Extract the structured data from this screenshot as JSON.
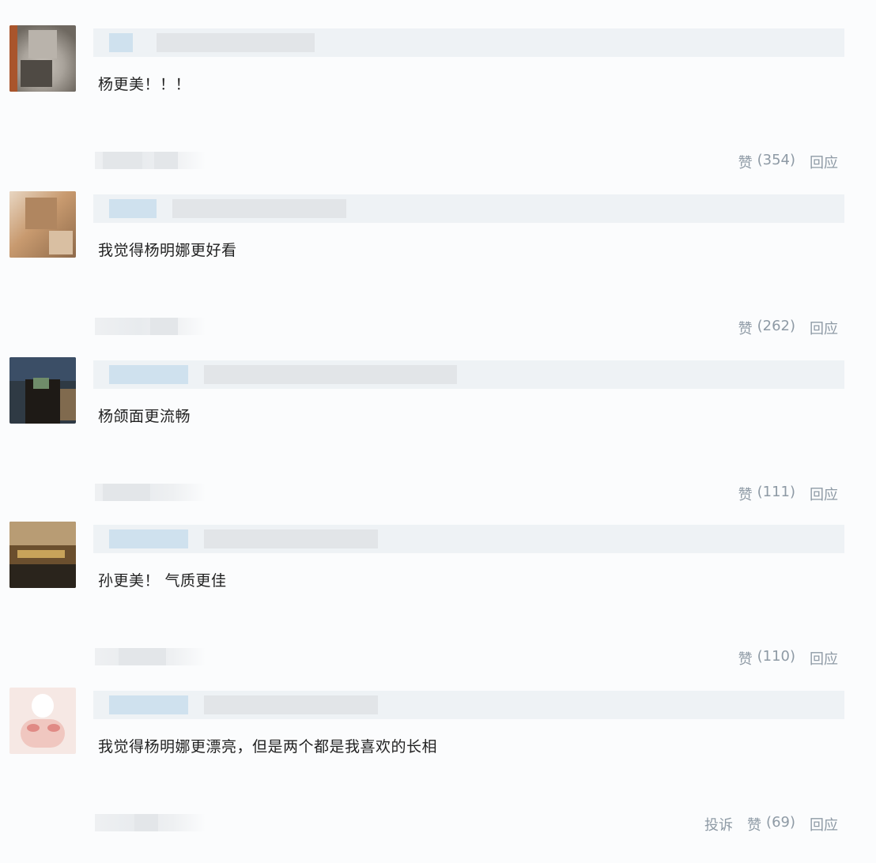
{
  "comments": [
    {
      "text": "杨更美！！！",
      "like_icon": "赞",
      "like_count": "(354)",
      "reply": "回应"
    },
    {
      "text": "我觉得杨明娜更好看",
      "like_icon": "赞",
      "like_count": "(262)",
      "reply": "回应"
    },
    {
      "text": "杨颌面更流畅",
      "like_icon": "赞",
      "like_count": "(111)",
      "reply": "回应"
    },
    {
      "text": "孙更美！ 气质更佳",
      "like_icon": "赞",
      "like_count": "(110)",
      "reply": "回应"
    },
    {
      "text": "我觉得杨明娜更漂亮，但是两个都是我喜欢的长相",
      "report": "投诉",
      "like_icon": "赞",
      "like_count": "(69)",
      "reply": "回应"
    }
  ],
  "colors": {
    "background": "#fbfcfd",
    "text": "#222222",
    "action": "#8e9aa5",
    "name_bar": "#eef2f5",
    "name_blur_blue": "#cfe1ee"
  }
}
